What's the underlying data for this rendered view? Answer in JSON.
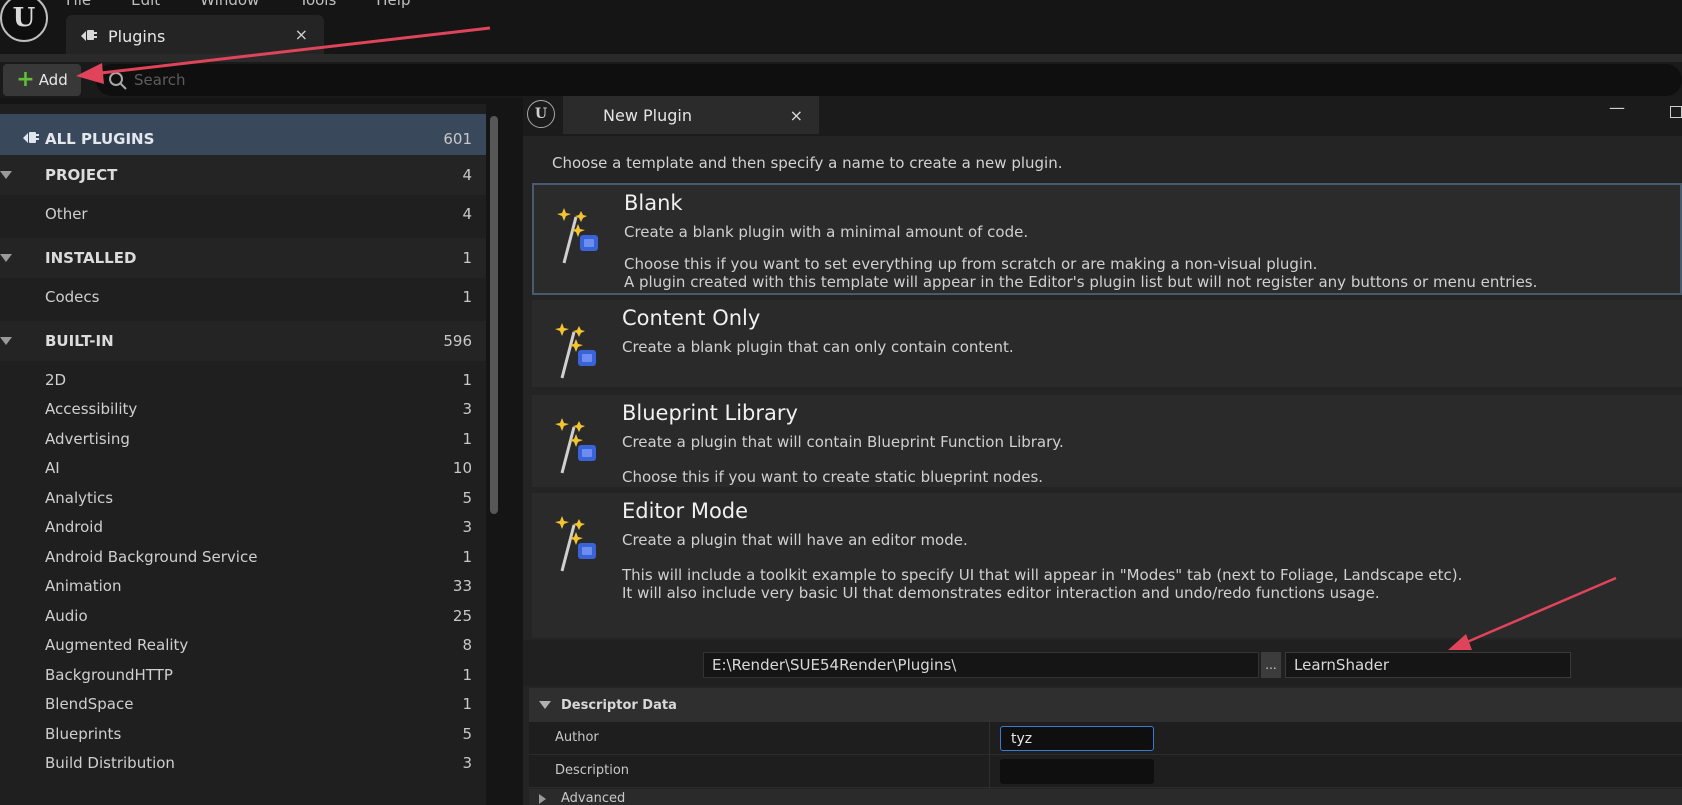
{
  "menu": [
    "File",
    "Edit",
    "Window",
    "Tools",
    "Help"
  ],
  "tab": {
    "label": "Plugins",
    "close": "×"
  },
  "toolbar": {
    "add_label": "Add",
    "add_glyph": "+",
    "search_placeholder": "Search"
  },
  "sidebar": {
    "all": {
      "label": "ALL PLUGINS",
      "count": "601"
    },
    "items": [
      {
        "label": "PROJECT",
        "count": "4",
        "header": true
      },
      {
        "label": "Other",
        "count": "4",
        "header": false
      },
      {
        "label": "INSTALLED",
        "count": "1",
        "header": true
      },
      {
        "label": "Codecs",
        "count": "1",
        "header": false
      },
      {
        "label": "BUILT-IN",
        "count": "596",
        "header": true
      },
      {
        "label": "2D",
        "count": "1",
        "header": false
      },
      {
        "label": "Accessibility",
        "count": "3",
        "header": false
      },
      {
        "label": "Advertising",
        "count": "1",
        "header": false
      },
      {
        "label": "AI",
        "count": "10",
        "header": false
      },
      {
        "label": "Analytics",
        "count": "5",
        "header": false
      },
      {
        "label": "Android",
        "count": "3",
        "header": false
      },
      {
        "label": "Android Background Service",
        "count": "1",
        "header": false
      },
      {
        "label": "Animation",
        "count": "33",
        "header": false
      },
      {
        "label": "Audio",
        "count": "25",
        "header": false
      },
      {
        "label": "Augmented Reality",
        "count": "8",
        "header": false
      },
      {
        "label": "BackgroundHTTP",
        "count": "1",
        "header": false
      },
      {
        "label": "BlendSpace",
        "count": "1",
        "header": false
      },
      {
        "label": "Blueprints",
        "count": "5",
        "header": false
      },
      {
        "label": "Build Distribution",
        "count": "3",
        "header": false
      }
    ]
  },
  "new_plugin": {
    "tab_label": "New Plugin",
    "close": "×",
    "minimize": "—",
    "intro": "Choose a template and then specify a name to create a new plugin.",
    "templates": [
      {
        "name": "Blank",
        "desc": "Create a blank plugin with a minimal amount of code.",
        "more": [
          "Choose this if you want to set everything up from scratch or are making a non-visual plugin.",
          "A plugin created with this template will appear in the Editor's plugin list but will not register any buttons or menu entries."
        ]
      },
      {
        "name": "Content Only",
        "desc": "Create a blank plugin that can only contain content.",
        "more": []
      },
      {
        "name": "Blueprint Library",
        "desc": "Create a plugin that will contain Blueprint Function Library.",
        "more": [
          "Choose this if you want to create static blueprint nodes."
        ]
      },
      {
        "name": "Editor Mode",
        "desc": "Create a plugin that will have an editor mode.",
        "more": [
          "This will include a toolkit example to specify UI that will appear in \"Modes\" tab (next to Foliage, Landscape etc).",
          "It will also include very basic UI that demonstrates editor interaction and undo/redo functions usage."
        ]
      }
    ],
    "path": "E:\\Render\\SUE54Render\\Plugins\\",
    "browse_label": "...",
    "plugin_name": "LearnShader",
    "descriptor": {
      "header": "Descriptor Data",
      "author_label": "Author",
      "author_value": "tyz",
      "description_label": "Description",
      "description_value": "",
      "advanced_label": "Advanced"
    }
  },
  "colors": {
    "accent": "#39495b",
    "annotation": "#e0445a",
    "add_plus": "#5fbe3a",
    "focus": "#3a7ad6"
  }
}
